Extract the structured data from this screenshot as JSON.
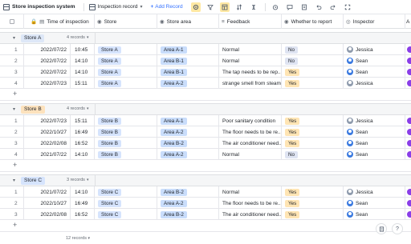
{
  "toolbar": {
    "title": "Store inspection system",
    "view_name": "Inspection record",
    "add_record_label": "Add Record",
    "add_icon": "plus-icon",
    "icons": [
      "filter-icon",
      "group-icon",
      "sort-icon",
      "row-height-icon",
      "fields-icon",
      "automation-icon",
      "comment-icon",
      "form-icon",
      "undo-icon",
      "redo-icon",
      "expand-icon"
    ]
  },
  "columns": {
    "time": "Time of inspection",
    "store": "Store",
    "area": "Store area",
    "feedback": "Feedback",
    "report": "Whether to report",
    "inspector": "Inspector",
    "last": "A"
  },
  "groups": [
    {
      "name": "Store A",
      "count": "4 records",
      "rows": [
        {
          "num": "1",
          "date": "2022/07/22",
          "time": "10:45",
          "store": "Store A",
          "area": "Area A-1",
          "feedback": "Normal",
          "report": "No",
          "inspector": "Jessica",
          "avatar": "jessica"
        },
        {
          "num": "2",
          "date": "2022/07/22",
          "time": "14:10",
          "store": "Store A",
          "area": "Area B-1",
          "feedback": "Normal",
          "report": "No",
          "inspector": "Sean",
          "avatar": "sean"
        },
        {
          "num": "3",
          "date": "2022/07/22",
          "time": "14:10",
          "store": "Store A",
          "area": "Area B-1",
          "feedback": "The tap needs to be rep...",
          "report": "Yes",
          "inspector": "Sean",
          "avatar": "sean"
        },
        {
          "num": "4",
          "date": "2022/07/23",
          "time": "15:11",
          "store": "Store A",
          "area": "Area A-2",
          "feedback": "strange smell from steam...",
          "report": "Yes",
          "inspector": "Jessica",
          "avatar": "jessica"
        }
      ]
    },
    {
      "name": "Store B",
      "count": "4 records",
      "rows": [
        {
          "num": "1",
          "date": "2022/07/23",
          "time": "15:11",
          "store": "Store B",
          "area": "Area A-1",
          "feedback": "Poor sanitary condition",
          "report": "Yes",
          "inspector": "Jessica",
          "avatar": "jessica"
        },
        {
          "num": "2",
          "date": "2022/10/27",
          "time": "16:49",
          "store": "Store B",
          "area": "Area A-2",
          "feedback": "The floor needs to be re...",
          "report": "Yes",
          "inspector": "Sean",
          "avatar": "sean"
        },
        {
          "num": "3",
          "date": "2022/02/08",
          "time": "16:52",
          "store": "Store B",
          "area": "Area B-2",
          "feedback": "The air conditioner need...",
          "report": "Yes",
          "inspector": "Sean",
          "avatar": "sean"
        },
        {
          "num": "4",
          "date": "2021/07/22",
          "time": "14:10",
          "store": "Store B",
          "area": "Area A-2",
          "feedback": "Normal",
          "report": "No",
          "inspector": "Sean",
          "avatar": "sean"
        }
      ]
    },
    {
      "name": "Store C",
      "count": "3 records",
      "rows": [
        {
          "num": "1",
          "date": "2021/07/22",
          "time": "14:10",
          "store": "Store C",
          "area": "Area B-2",
          "feedback": "Normal",
          "report": "Yes",
          "inspector": "Jessica",
          "avatar": "jessica"
        },
        {
          "num": "2",
          "date": "2022/10/27",
          "time": "16:49",
          "store": "Store C",
          "area": "Area A-2",
          "feedback": "The floor needs to be re...",
          "report": "Yes",
          "inspector": "Sean",
          "avatar": "sean"
        },
        {
          "num": "3",
          "date": "2022/02/08",
          "time": "16:52",
          "store": "Store C",
          "area": "Area B-2",
          "feedback": "The air conditioner need...",
          "report": "Yes",
          "inspector": "Sean",
          "avatar": "sean"
        }
      ]
    }
  ],
  "colors": {
    "store_a_pill": "#dde7f7",
    "store_b_pill": "#fde2bd",
    "store_c_pill": "#d6e4fd",
    "accent": "#3370ff"
  },
  "footer": {
    "total": "12 records"
  }
}
